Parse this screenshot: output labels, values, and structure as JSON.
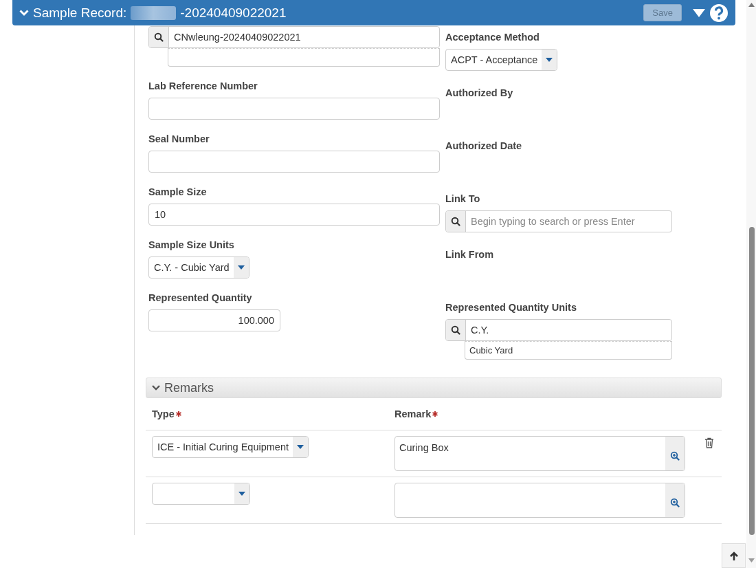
{
  "header": {
    "title": "Sample Record:",
    "title_suffix": "-20240409022021",
    "save_button": {
      "label": "Save",
      "disabled": true
    }
  },
  "left_fields": [
    {
      "kind": "lookup",
      "value": "CNwleung-20240409022021"
    },
    {
      "kind": "text",
      "label": "Lab Reference Number"
    },
    {
      "kind": "text",
      "label": "Seal Number"
    },
    {
      "kind": "text",
      "label": "Sample Size",
      "value": "10"
    },
    {
      "kind": "select",
      "label": "Sample Size Units",
      "value": "C.Y. - Cubic Yard"
    },
    {
      "kind": "number",
      "label": "Represented Quantity",
      "value": "100.000"
    }
  ],
  "right_fields": [
    {
      "kind": "select",
      "label": "Acceptance Method",
      "value": "ACPT - Acceptance"
    },
    {
      "kind": "static",
      "label": "Authorized By"
    },
    {
      "kind": "static",
      "label": "Authorized Date"
    },
    {
      "kind": "lookup",
      "label": "Link To",
      "placeholder": "Begin typing to search or press Enter"
    },
    {
      "kind": "static",
      "label": "Link From"
    },
    {
      "kind": "lookup",
      "label": "Represented Quantity Units",
      "value": "C.Y.",
      "suggestion": "Cubic Yard"
    }
  ],
  "remarks": {
    "title": "Remarks",
    "columns": [
      {
        "label": "Type",
        "required": true
      },
      {
        "label": "Remark",
        "required": true
      }
    ],
    "rows": [
      {
        "type": "ICE - Initial Curing Equipment",
        "remark": "Curing Box",
        "deletable": true
      },
      {
        "deletable": false
      }
    ]
  }
}
